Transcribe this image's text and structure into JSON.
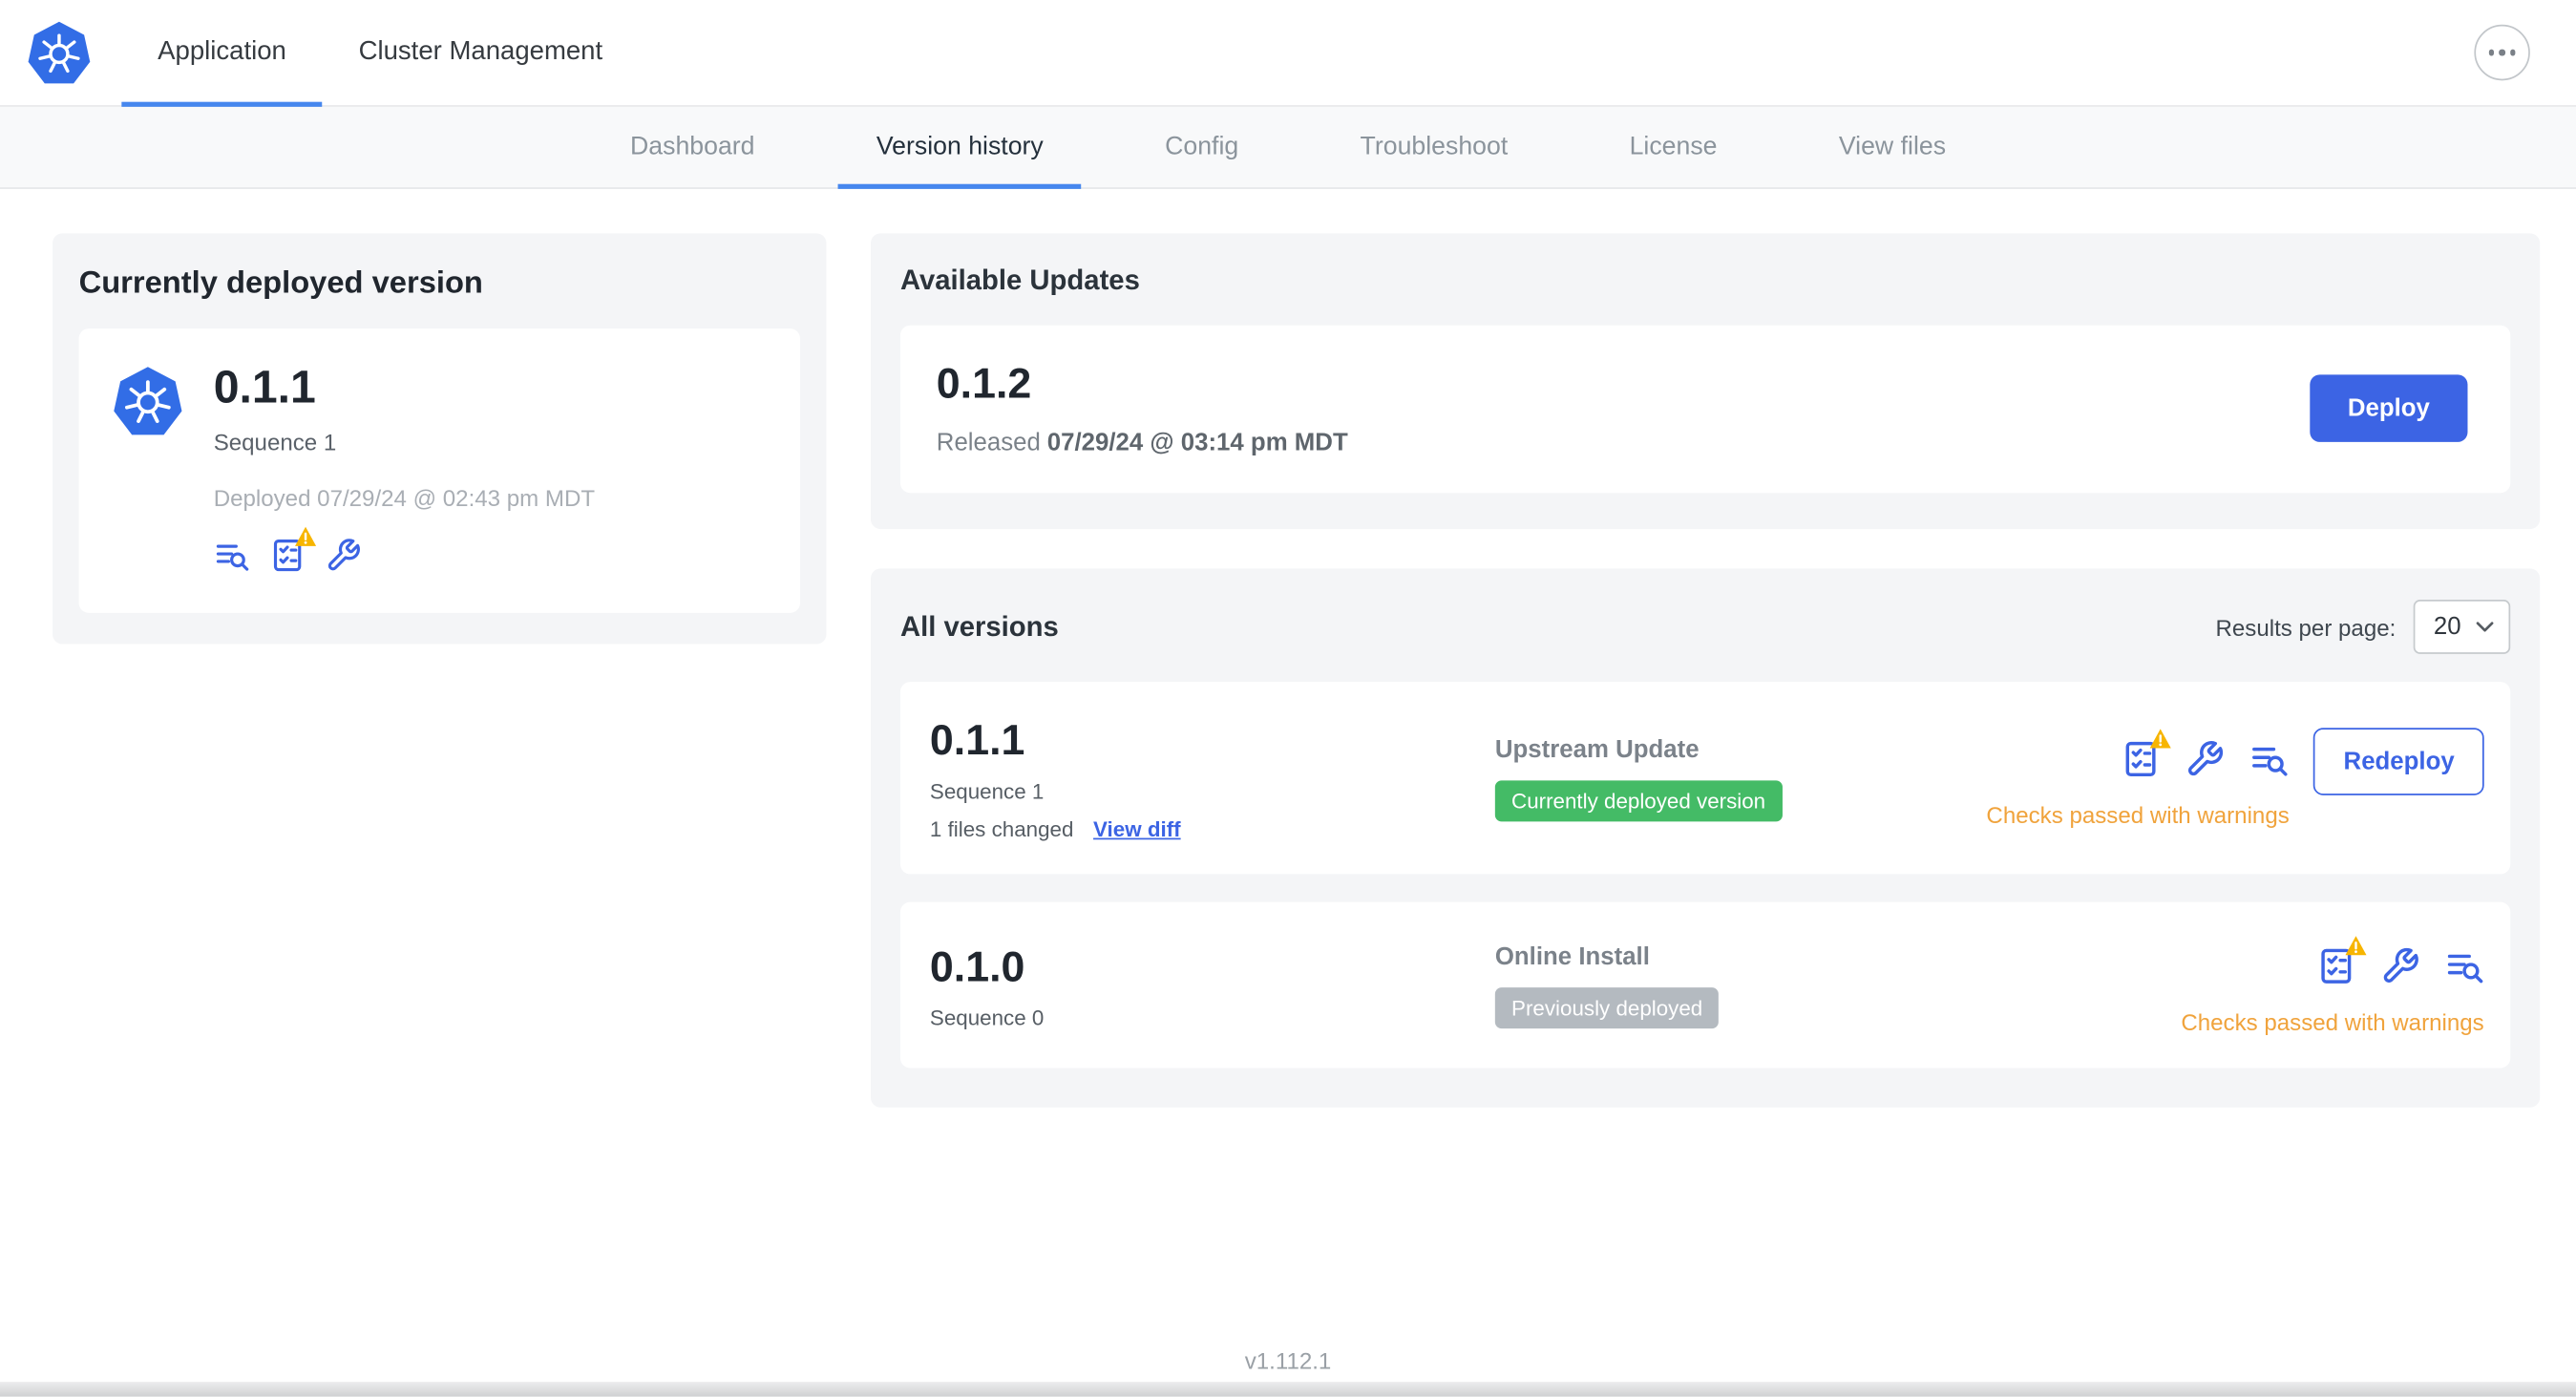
{
  "header": {
    "tabs": [
      {
        "label": "Application",
        "active": true
      },
      {
        "label": "Cluster Management",
        "active": false
      }
    ]
  },
  "subnav": {
    "tabs": [
      "Dashboard",
      "Version history",
      "Config",
      "Troubleshoot",
      "License",
      "View files"
    ],
    "active": "Version history"
  },
  "current_version": {
    "title": "Currently deployed version",
    "version": "0.1.1",
    "sequence": "Sequence 1",
    "deployed": "Deployed 07/29/24 @ 02:43 pm MDT"
  },
  "available_updates": {
    "title": "Available Updates",
    "version": "0.1.2",
    "released_prefix": "Released",
    "released_date": "07/29/24 @ 03:14 pm MDT",
    "deploy_label": "Deploy"
  },
  "all_versions": {
    "title": "All versions",
    "results_per_page_label": "Results per page:",
    "results_per_page_value": "20",
    "rows": [
      {
        "version": "0.1.1",
        "sequence": "Sequence 1",
        "files_changed": "1 files changed",
        "view_diff": "View diff",
        "source": "Upstream Update",
        "badge": "Currently deployed version",
        "badge_type": "green",
        "status": "Checks passed with warnings",
        "action": "Redeploy"
      },
      {
        "version": "0.1.0",
        "sequence": "Sequence 0",
        "source": "Online Install",
        "badge": "Previously deployed",
        "badge_type": "gray",
        "status": "Checks passed with warnings"
      }
    ]
  },
  "footer": {
    "version": "v1.112.1"
  },
  "icons": {
    "logo": "kubernetes-wheel",
    "more": "ellipsis",
    "preflight": "checklist",
    "warning": "triangle-exclamation",
    "config": "wrench",
    "logs": "lines-magnifier",
    "select": "chevron-down"
  },
  "colors": {
    "accent": "#3c64e4",
    "tab_underline": "#4687ee",
    "badge_green": "#44bb66",
    "badge_gray": "#b4bac0",
    "warning_text": "#f0a33c",
    "warning_triangle": "#f7b500",
    "k8s_blue": "#326de6"
  }
}
